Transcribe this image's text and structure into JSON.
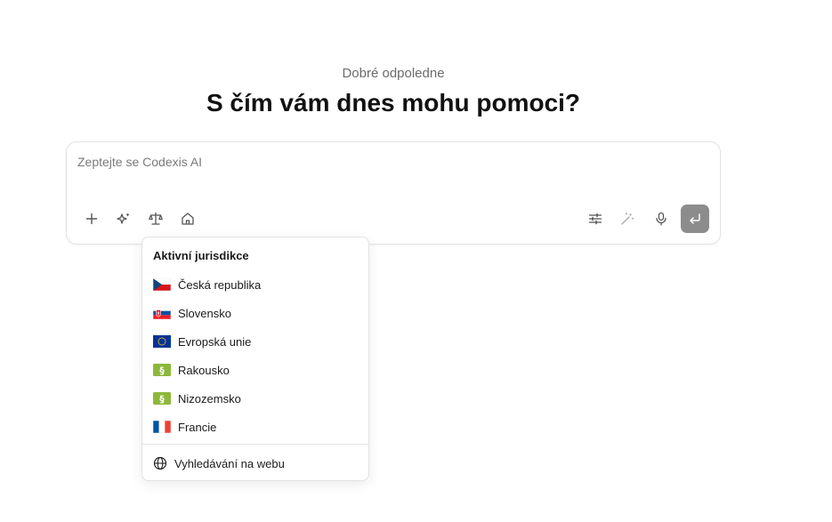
{
  "header": {
    "greeting": "Dobré odpoledne",
    "headline": "S čím vám dnes mohu pomoci?"
  },
  "composer": {
    "placeholder": "Zeptejte se Codexis AI",
    "value": "",
    "left_tools": [
      "plus-icon",
      "sparkle-icon",
      "scales-icon",
      "home-icon"
    ],
    "right_tools": [
      "sliders-icon",
      "magic-wand-icon",
      "microphone-icon"
    ],
    "send_icon": "enter-icon",
    "send_bg": "#8c8c8c"
  },
  "jurisdiction_menu": {
    "title": "Aktivní jurisdikce",
    "items": [
      {
        "label": "Česká republika",
        "flag": "cz-flag-icon"
      },
      {
        "label": "Slovensko",
        "flag": "sk-flag-icon"
      },
      {
        "label": "Evropská unie",
        "flag": "eu-flag-icon"
      },
      {
        "label": "Rakousko",
        "flag": "paragraph-icon"
      },
      {
        "label": "Nizozemsko",
        "flag": "paragraph-icon"
      },
      {
        "label": "Francie",
        "flag": "fr-flag-icon"
      }
    ],
    "web_search": {
      "label": "Vyhledávání na webu",
      "icon": "globe-icon"
    }
  }
}
